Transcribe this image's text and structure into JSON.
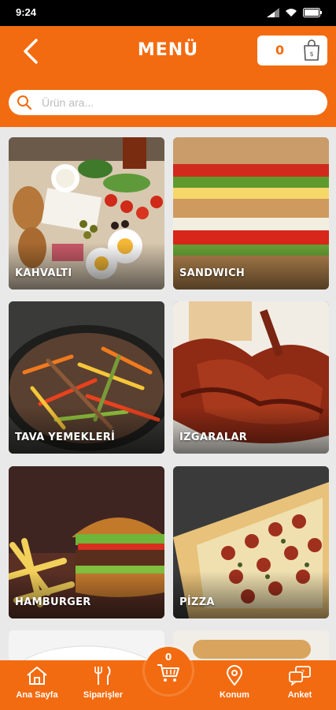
{
  "status_bar": {
    "time": "9:24"
  },
  "header": {
    "title": "MENÜ",
    "cart_count": "0"
  },
  "search": {
    "placeholder": "Ürün ara..."
  },
  "categories": [
    {
      "label": "KAHVALTI"
    },
    {
      "label": "SANDWICH"
    },
    {
      "label": "TAVA YEMEKLERİ"
    },
    {
      "label": "IZGARALAR"
    },
    {
      "label": "HAMBURGER"
    },
    {
      "label": "PİZZA"
    }
  ],
  "bottom_nav": {
    "cart_count": "0",
    "items": [
      {
        "label": "Ana Sayfa",
        "icon": "home-icon"
      },
      {
        "label": "Siparişler",
        "icon": "fork-knife-icon"
      },
      {
        "label": "Konum",
        "icon": "location-pin-icon"
      },
      {
        "label": "Anket",
        "icon": "survey-chat-icon"
      }
    ]
  },
  "colors": {
    "brand": "#f36b10",
    "background": "#e9e9e9"
  }
}
